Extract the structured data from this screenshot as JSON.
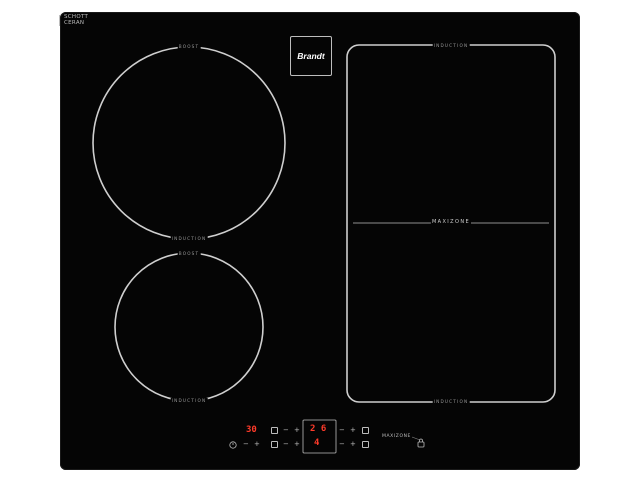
{
  "brand": {
    "logo_text": "Brandt",
    "glass_maker_line1": "SCHOTT",
    "glass_maker_line2": "CERAN"
  },
  "zones": {
    "top_left": {
      "top_label": "BOOST",
      "bottom_label": "INDUCTION"
    },
    "bottom_left": {
      "top_label": "BOOST",
      "bottom_label": "INDUCTION"
    },
    "right": {
      "top_label": "INDUCTION",
      "bottom_label": "INDUCTION",
      "center_label": "MAXIZONE"
    }
  },
  "controls": {
    "timer_display": "30",
    "display_top_right": "2 6",
    "display_bottom": "4",
    "minus": "−",
    "plus": "+",
    "small_maxizone": "MAXIZONE"
  },
  "colors": {
    "glass": "#050505",
    "print": "#bdbdbd",
    "led": "#ff3b2a"
  }
}
